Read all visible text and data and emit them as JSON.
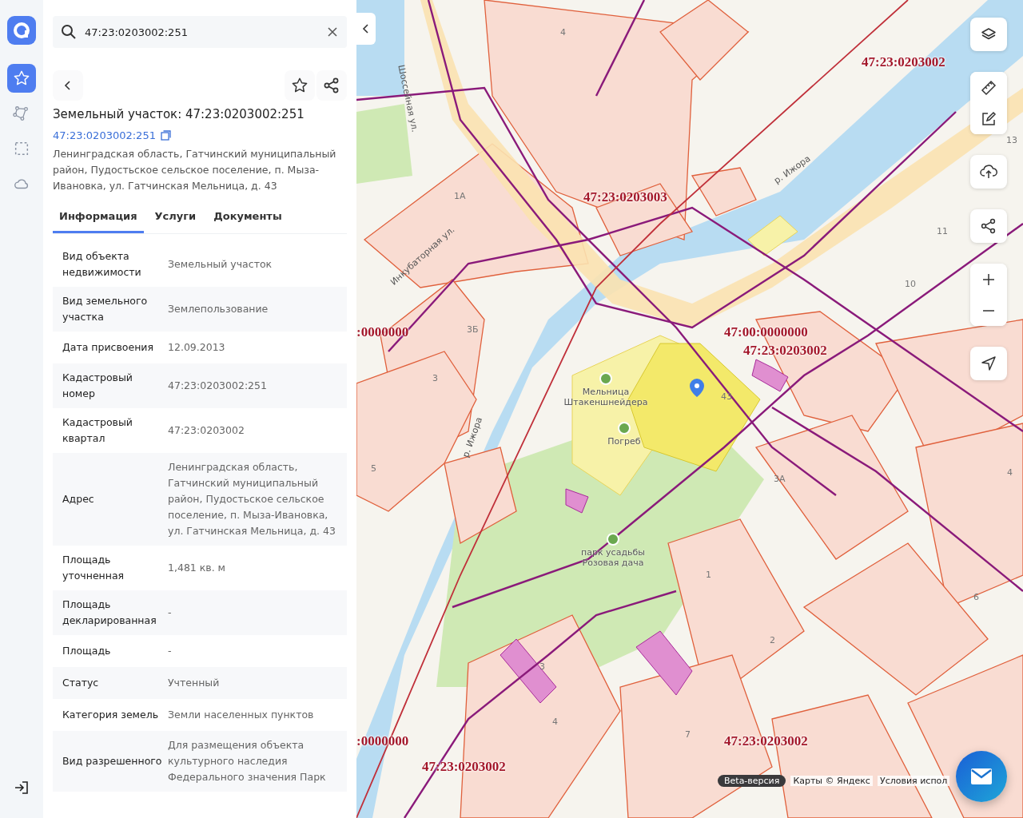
{
  "rail": {
    "items": [
      {
        "selected": true
      },
      {
        "selected": false
      },
      {
        "selected": false
      },
      {
        "selected": false
      }
    ]
  },
  "search": {
    "value": "47:23:0203002:251"
  },
  "object": {
    "title": "Земельный участок: 47:23:0203002:251",
    "number_link": "47:23:0203002:251",
    "address": "Ленинградская область, Гатчинский муниципальный район, Пудостьское сельское поселение, п. Мыза-Ивановка, ул. Гатчинская Мельница, д. 43"
  },
  "tabs": [
    {
      "label": "Информация",
      "selected": true
    },
    {
      "label": "Услуги",
      "selected": false
    },
    {
      "label": "Документы",
      "selected": false
    }
  ],
  "rows": [
    {
      "label": "Вид объекта недвижимости",
      "value": "Земельный участок"
    },
    {
      "label": "Вид земельного участка",
      "value": "Землепользование"
    },
    {
      "label": "Дата присвоения",
      "value": "12.09.2013"
    },
    {
      "label": "Кадастровый номер",
      "value": "47:23:0203002:251"
    },
    {
      "label": "Кадастровый квартал",
      "value": "47:23:0203002"
    },
    {
      "label": "Адрес",
      "value": "Ленинградская область, Гатчинский муниципальный район, Пудостьское сельское поселение, п. Мыза-Ивановка, ул. Гатчинская Мельница, д. 43"
    },
    {
      "label": "Площадь уточненная",
      "value": "1,481 кв. м"
    },
    {
      "label": "Площадь декларированная",
      "value": "-"
    },
    {
      "label": "Площадь",
      "value": "-"
    },
    {
      "label": "Статус",
      "value": "Учтенный"
    },
    {
      "label": "Категория земель",
      "value": "Земли населенных пунктов"
    },
    {
      "label": "Вид разрешенного",
      "value": "Для размещения объекта культурного наследия Федерального значения Парк"
    }
  ],
  "map": {
    "quarter_labels": [
      "47:23:0203002",
      "47:23:0203003",
      ":0000000",
      "47:00:0000000",
      "47:23:0203002",
      ":0000000",
      "47:23:0203002",
      "47:23:0203002"
    ],
    "street_labels": [
      "Шоссейная ул.",
      "р. Ижора",
      "Инкубаторная ул.",
      "р. Ижора"
    ],
    "house_numbers": [
      "4",
      "1А",
      "3Б",
      "3",
      "5",
      "43",
      "11",
      "10",
      "13",
      "3А",
      "4",
      "6",
      "1",
      "2",
      "7",
      "4",
      "3"
    ],
    "places": [
      "Мельница Штакеншнейдера",
      "Погреб",
      "парк усадьбы Розовая дача"
    ]
  },
  "footer": {
    "badge": "Beta-версия",
    "attribution": "Карты © Яндекс",
    "terms": "Условия испол"
  }
}
